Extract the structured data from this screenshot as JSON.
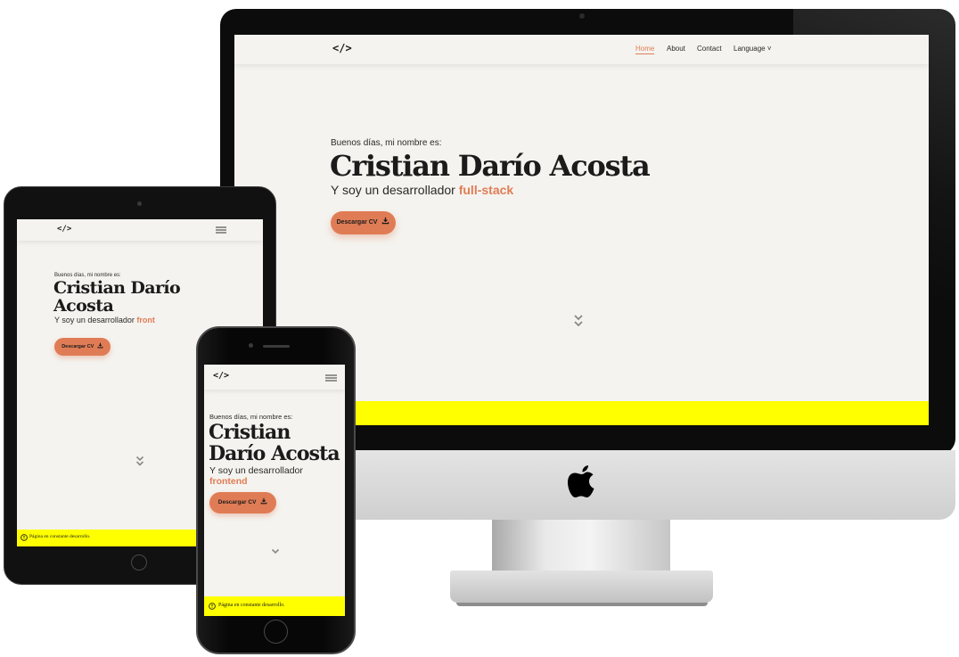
{
  "desktop": {
    "nav": {
      "logo": "</>",
      "links": [
        {
          "label": "Home",
          "active": true
        },
        {
          "label": "About"
        },
        {
          "label": "Contact"
        },
        {
          "label": "Language ˅"
        }
      ]
    },
    "hero": {
      "greeting": "Buenos días, mi nombre es:",
      "name": "Cristian Darío Acosta",
      "role_prefix": "Y soy un desarrollador ",
      "role_highlight": "full-stack",
      "button_label": "Descargar CV"
    }
  },
  "tablet": {
    "nav": {
      "logo": "</>"
    },
    "hero": {
      "greeting": "Buenos días, mi nombre es:",
      "name": "Cristian Darío Acosta",
      "role_prefix": "Y soy un desarrollador ",
      "role_highlight": "front",
      "button_label": "Descargar CV"
    },
    "banner_text": "Página en constante desarrollo."
  },
  "phone": {
    "nav": {
      "logo": "</>"
    },
    "hero": {
      "greeting": "Buenos días, mi nombre es:",
      "name": "Cristian Darío Acosta",
      "role_prefix": "Y soy un desarrollador ",
      "role_highlight": "frontend",
      "button_label": "Descargar CV"
    },
    "banner_text": "Página en constante desarrollo."
  },
  "colors": {
    "accent": "#e07c55",
    "background": "#f4f3ef",
    "banner": "#ffff00",
    "text": "#1b1b1b"
  }
}
